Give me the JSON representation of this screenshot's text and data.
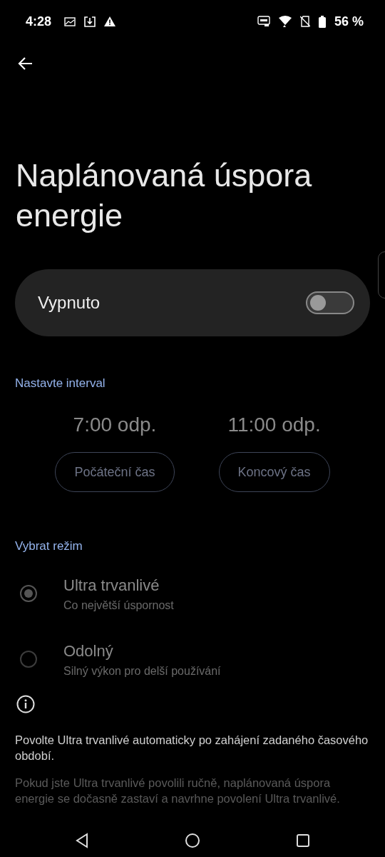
{
  "status_bar": {
    "time": "4:28",
    "battery": "56 %"
  },
  "title": "Naplánovaná úspora energie",
  "master_switch": {
    "label": "Vypnuto",
    "on": false
  },
  "interval": {
    "heading": "Nastavte interval",
    "disabled": true,
    "times": [
      {
        "value": "7:00 odp.",
        "button": "Počáteční čas"
      },
      {
        "value": "11:00 odp.",
        "button": "Koncový čas"
      }
    ]
  },
  "mode": {
    "heading": "Vybrat režim",
    "disabled": true,
    "options": [
      {
        "title": "Ultra trvanlivé",
        "subtitle": "Co největší úspornost",
        "selected": true
      },
      {
        "title": "Odolný",
        "subtitle": "Silný výkon pro delší používání",
        "selected": false
      }
    ]
  },
  "info": [
    "Povolte Ultra trvanlivé automaticky po zahájení zadaného časového období.",
    "Pokud jste Ultra trvanlivé povolili ručně, naplánovaná úspora energie se dočasně zastaví a navrhne povolení Ultra trvanlivé."
  ]
}
